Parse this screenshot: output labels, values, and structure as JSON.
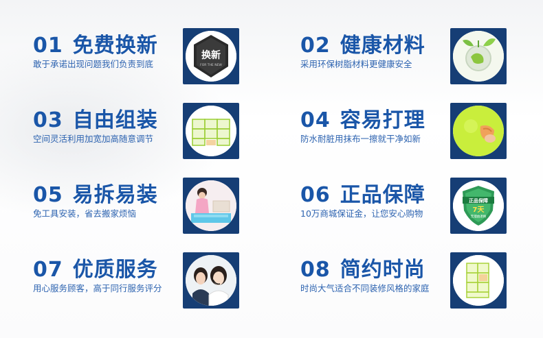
{
  "features": [
    {
      "num": "01",
      "title": "免费换新",
      "desc": "敢于承诺出现问题我们负责到底",
      "icon": "badge-icon",
      "badge_text": "换新",
      "badge_sub": "FOR THE NEW"
    },
    {
      "num": "02",
      "title": "健康材料",
      "desc": "采用环保树脂材料更健康安全",
      "icon": "eco-globe-icon"
    },
    {
      "num": "03",
      "title": "自由组装",
      "desc": "空间灵活利用加宽加高随意调节",
      "icon": "shelf-icon"
    },
    {
      "num": "04",
      "title": "容易打理",
      "desc": "防水耐脏用抹布一擦就干净如新",
      "icon": "cleaning-icon"
    },
    {
      "num": "05",
      "title": "易拆易装",
      "desc": "免工具安装，省去搬家烦恼",
      "icon": "woman-assembling-icon"
    },
    {
      "num": "06",
      "title": "正品保障",
      "desc": "10万商城保证金，让您安心购物",
      "icon": "shield-icon",
      "shield_text": "正品保障",
      "shield_days": "7天",
      "shield_sub": "无理由退换"
    },
    {
      "num": "07",
      "title": "优质服务",
      "desc": "用心服务顾客，高于同行服务评分",
      "icon": "customer-service-icon"
    },
    {
      "num": "08",
      "title": "简约时尚",
      "desc": "时尚大气适合不同装修风格的家庭",
      "icon": "cabinet-icon"
    }
  ],
  "colors": {
    "title": "#1a56a8",
    "desc": "#2d63b0",
    "frame": "#163e75"
  }
}
